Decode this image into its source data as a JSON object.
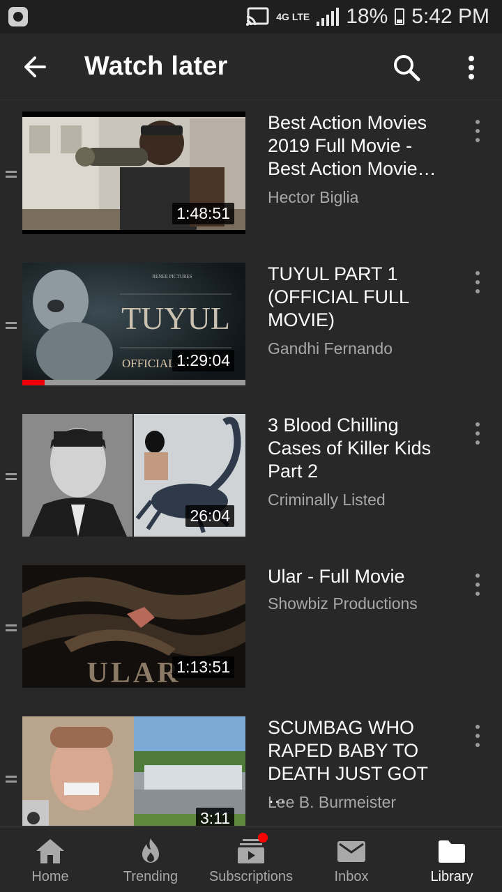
{
  "status_bar": {
    "network": "4G LTE",
    "battery": "18%",
    "time": "5:42 PM"
  },
  "header": {
    "title": "Watch later",
    "icons": [
      "back-arrow-icon",
      "search-icon",
      "more-vert-icon"
    ]
  },
  "videos": [
    {
      "title": "Best Action Movies 2019 Full Movie - Best Action Movie…",
      "channel": "Hector Biglia",
      "duration": "1:48:51",
      "watched_fraction": 0
    },
    {
      "title": "TUYUL PART 1 (OFFICIAL FULL MOVIE)",
      "channel": "Gandhi Fernando",
      "duration": "1:29:04",
      "watched_fraction": 0.1
    },
    {
      "title": "3 Blood Chilling Cases of Killer Kids Part 2",
      "channel": "Criminally Listed",
      "duration": "26:04",
      "watched_fraction": 0
    },
    {
      "title": "Ular - Full Movie",
      "channel": "Showbiz Productions",
      "duration": "1:13:51",
      "watched_fraction": 0
    },
    {
      "title": "SCUMBAG WHO RAPED BABY TO DEATH JUST GOT …",
      "channel": "Lee B. Burmeister",
      "duration": "3:11",
      "watched_fraction": 0
    }
  ],
  "thumb_text": {
    "tuyul_title": "TUYUL",
    "tuyul_official": "OFFICIAL",
    "ular_title": "ULAR"
  },
  "bottom_nav": [
    {
      "label": "Home",
      "icon": "home-icon"
    },
    {
      "label": "Trending",
      "icon": "flame-icon"
    },
    {
      "label": "Subscriptions",
      "icon": "subscriptions-icon"
    },
    {
      "label": "Inbox",
      "icon": "mail-icon"
    },
    {
      "label": "Library",
      "icon": "folder-icon",
      "active": true
    }
  ],
  "colors": {
    "background": "#282828",
    "status_bar": "#1f1f1f",
    "accent_red": "#ff0000",
    "secondary_text": "#a8a8a8"
  }
}
